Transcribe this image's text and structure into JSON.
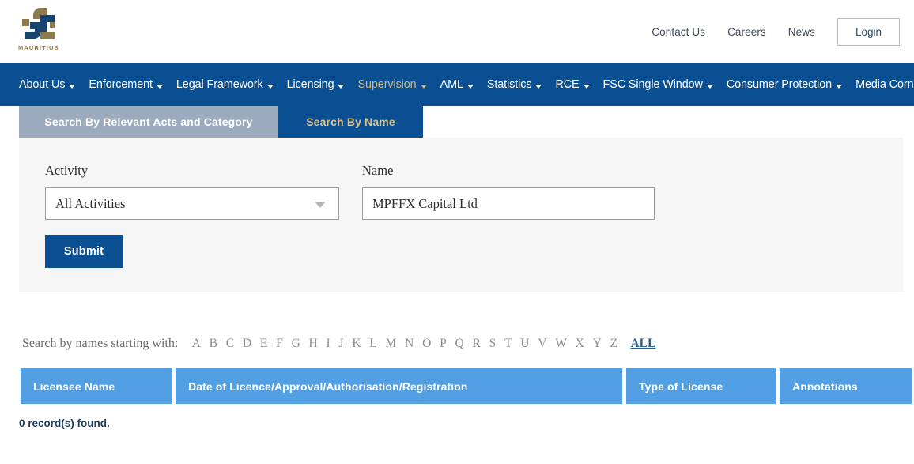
{
  "brand": {
    "logo_caption": "MAURITIUS",
    "logo_colors": {
      "gold": "#8d7a4e",
      "navy": "#16446e"
    }
  },
  "topbar": {
    "links": [
      {
        "label": "Contact Us",
        "name": "contact-us"
      },
      {
        "label": "Careers",
        "name": "careers"
      },
      {
        "label": "News",
        "name": "news"
      }
    ],
    "login_label": "Login"
  },
  "mainnav": {
    "background": "#0b4f93",
    "active_color": "#cdbb8e",
    "items": [
      {
        "label": "About Us",
        "caret": true,
        "active": false
      },
      {
        "label": "Enforcement",
        "caret": true,
        "active": false
      },
      {
        "label": "Legal Framework",
        "caret": true,
        "active": false
      },
      {
        "label": "Licensing",
        "caret": true,
        "active": false
      },
      {
        "label": "Supervision",
        "caret": true,
        "active": true
      },
      {
        "label": "AML",
        "caret": true,
        "active": false
      },
      {
        "label": "Statistics",
        "caret": true,
        "active": false
      },
      {
        "label": "RCE",
        "caret": true,
        "active": false
      },
      {
        "label": "FSC Single Window",
        "caret": true,
        "active": false
      },
      {
        "label": "Consumer Protection",
        "caret": true,
        "active": false
      },
      {
        "label": "Media Corner",
        "caret": true,
        "active": false
      }
    ]
  },
  "tabs": [
    {
      "label": "Search By Relevant Acts and Category",
      "active": false
    },
    {
      "label": "Search By Name",
      "active": true
    }
  ],
  "form": {
    "activity_label": "Activity",
    "activity_value": "All Activities",
    "activity_options": [
      "All Activities"
    ],
    "name_label": "Name",
    "name_value": "MPFFX Capital Ltd",
    "name_placeholder": "",
    "submit_label": "Submit"
  },
  "alphabet": {
    "intro": "Search by names starting with:",
    "letters": [
      "A",
      "B",
      "C",
      "D",
      "E",
      "F",
      "G",
      "H",
      "I",
      "J",
      "K",
      "L",
      "M",
      "N",
      "O",
      "P",
      "Q",
      "R",
      "S",
      "T",
      "U",
      "V",
      "W",
      "X",
      "Y",
      "Z"
    ],
    "all_label": "ALL",
    "all_color": "#2a5d94"
  },
  "results_table": {
    "header_color": "#539fe4",
    "columns": [
      "Licensee Name",
      "Date of Licence/Approval/Authorisation/Registration",
      "Type of License",
      "Annotations"
    ],
    "rows": [],
    "record_count_text": "0 record(s) found."
  }
}
